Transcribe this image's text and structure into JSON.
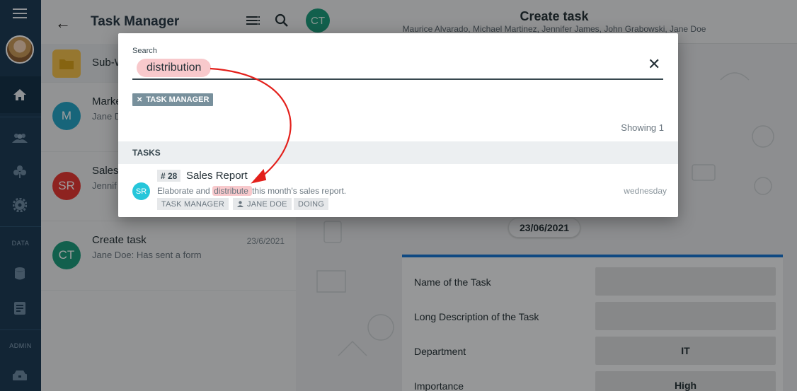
{
  "rail": {
    "sections": [
      "DATA",
      "ADMIN"
    ],
    "icons": [
      "menu-icon",
      "home-icon",
      "people-icon",
      "club-icon",
      "gear-icon",
      "database-icon",
      "document-icon",
      "admin-icon"
    ]
  },
  "list": {
    "title": "Task Manager",
    "rows": [
      {
        "initials": "",
        "name": "Sub-W",
        "sub": "",
        "date": "",
        "color": "#f2c14e"
      },
      {
        "initials": "M",
        "name": "Marke",
        "sub": "Jane D",
        "date": "",
        "color": "#26a3c6"
      },
      {
        "initials": "SR",
        "name": "Sales",
        "sub": "Jennif",
        "date": "",
        "color": "#e53935"
      },
      {
        "initials": "CT",
        "name": "Create task",
        "sub": "Jane Doe: Has sent a form",
        "date": "23/6/2021",
        "color": "#1d9b7c"
      }
    ]
  },
  "main": {
    "avatar": "CT",
    "title": "Create task",
    "participants": "Maurice Alvarado, Michael Martinez, Jennifer James, John Grabowski, Jane Doe",
    "date_pill": "23/06/2021",
    "form": [
      {
        "label": "Name of the Task",
        "value": ""
      },
      {
        "label": "Long Description of the Task",
        "value": ""
      },
      {
        "label": "Department",
        "value": "IT"
      },
      {
        "label": "Importance",
        "value": "High"
      }
    ]
  },
  "dialog": {
    "search_label": "Search",
    "search_value": "distribution",
    "filter_chip": "TASK MANAGER",
    "showing": "Showing 1",
    "section": "TASKS",
    "result": {
      "avatar": "SR",
      "number": "# 28",
      "title": "Sales Report",
      "desc_before": "Elaborate and ",
      "desc_highlight": "distribute ",
      "desc_after": "this month's sales report.",
      "day": "wednesday",
      "tags": [
        "TASK MANAGER",
        "JANE DOE",
        "DOING"
      ]
    }
  },
  "colors": {
    "rail": "#1e3c56",
    "highlight": "#f8c9cc",
    "accent": "#1976d2",
    "arrow": "#e3201b"
  }
}
